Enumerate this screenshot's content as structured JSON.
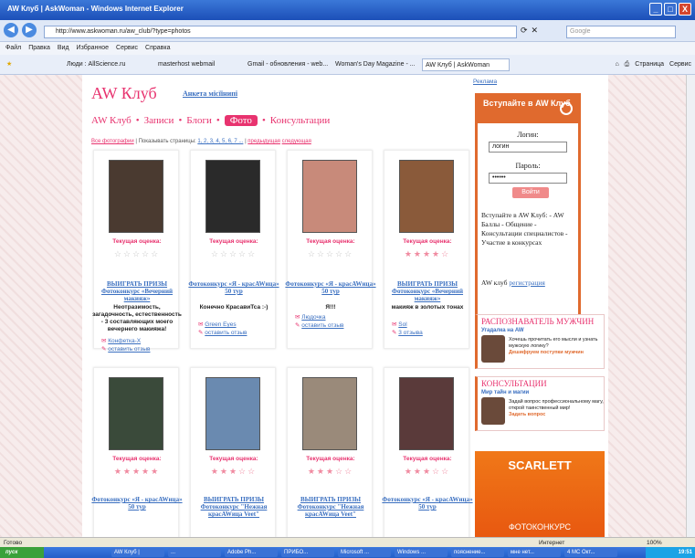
{
  "window": {
    "title": "AW Клуб | AskWoman - Windows Internet Explorer",
    "controls": [
      "_",
      "□",
      "X"
    ]
  },
  "address": {
    "url": "http://www.askwoman.ru/aw_club/?type=photos",
    "search_placeholder": "Google"
  },
  "menu": [
    "Файл",
    "Правка",
    "Вид",
    "Избранное",
    "Сервис",
    "Справка"
  ],
  "favorites": [
    "Люди : AllScience.ru",
    "masterhost webmail",
    "Gmail - обновления - web...",
    "Woman's Day Magazine - ...",
    "AW Клуб | AskWoman"
  ],
  "right_tools": {
    "page": "Страница",
    "service": "Сервис"
  },
  "site": {
    "title": "AW Клуб",
    "anketa": "Анкета місїїнипі",
    "tabs": [
      "AW Клуб",
      "Записи",
      "Блоги",
      "Фото",
      "Консультации"
    ],
    "active_tab": "Фото",
    "pager": {
      "all": "Все фотографии",
      "show": "| Показывать страницы:",
      "pages": "1, 2, 3, 4, 5, 6, 7 ...",
      "sep": "|",
      "prev": "предыдущая",
      "next": "следующая"
    }
  },
  "cards": [
    {
      "rating_label": "Текущая оценка:",
      "stars": "☆☆☆☆☆",
      "contest": "ВЫИГРАТЬ ПРИЗЫ Фотоконкурс «Вечерний макияж»",
      "caption": "Неотразимость, загадочность, естественность - 3 составляющих моего вечернего макияжа!",
      "author": "Конфетка-Х",
      "reply": "оставить отзыв",
      "photo": "#4a3a30"
    },
    {
      "rating_label": "Текущая оценка:",
      "stars": "☆☆☆☆☆",
      "contest": "Фотоконкурс «Я - красAWица» 50 тур",
      "caption": "Конечно КрасавиТса :-)",
      "author": "Green Eyes",
      "reply": "оставить отзыв",
      "photo": "#2a2a2a"
    },
    {
      "rating_label": "Текущая оценка:",
      "stars": "☆☆☆☆☆",
      "contest": "Фотоконкурс «Я - красAWица» 50 тур",
      "caption": "Я!!!",
      "author": "Людочка",
      "reply": "оставить отзыв",
      "photo": "#c88a7a"
    },
    {
      "rating_label": "Текущая оценка:",
      "stars": "★★★★☆",
      "contest": "ВЫИГРАТЬ ПРИЗЫ Фотоконкурс «Вечерний макияж»",
      "caption": "макияж в золотых тонах",
      "author": "Sol",
      "reply": "3 отзыва",
      "photo": "#8a5a3a"
    },
    {
      "rating_label": "Текущая оценка:",
      "stars": "★★★★★",
      "contest": "Фотоконкурс «Я - красAWица» 50 тур",
      "caption": "",
      "author": "",
      "reply": "",
      "photo": "#3a4a3a"
    },
    {
      "rating_label": "Текущая оценка:",
      "stars": "★★★☆☆",
      "contest": "ВЫИГРАТЬ ПРИЗЫ Фотоконкурс \"Нежная красAWица Veet\"",
      "caption": "",
      "author": "",
      "reply": "",
      "photo": "#6a8ab0"
    },
    {
      "rating_label": "Текущая оценка:",
      "stars": "★★★☆☆",
      "contest": "ВЫИГРАТЬ ПРИЗЫ Фотоконкурс \"Нежная красAWица Veet\"",
      "caption": "",
      "author": "",
      "reply": "",
      "photo": "#9a8a7a"
    },
    {
      "rating_label": "Текущая оценка:",
      "stars": "★★★☆☆",
      "contest": "Фотоконкурс «Я - красAWица» 50 тур",
      "caption": "",
      "author": "",
      "reply": "",
      "photo": "#5a3a3a"
    }
  ],
  "sidebar": {
    "reklama": "Реклама",
    "login_title": "Вступайте в AW Клуб",
    "login_label": "Логин:",
    "login_value": "логин",
    "password_label": "Пароль:",
    "password_value": "••••••",
    "submit": "Войти",
    "club_text": "Вступайте в AW Клуб: - AW Баллы - Общение - Консультации специалистов - Участие в конкурсах",
    "club_link_pre": "AW клуб",
    "club_link": "регистрация",
    "promo1_title": "РАСПОЗНАВАТЕЛЬ МУЖЧИН",
    "promo1_sub": "Угадалка на AW",
    "promo1_text": "Хочешь прочитать его мысли и узнать мужскую логику?",
    "promo1_link": "Дешифруем поступки мужчин",
    "promo2_title": "КОНСУЛЬТАЦИИ",
    "promo2_sub": "Мир тайн и магии",
    "promo2_text": "Задай вопрос профессиональному магу, открой таинственный мир!",
    "promo2_link": "Задать вопрос",
    "ad_brand": "SCARLETT",
    "ad_text": "ФОТОКОНКУРС"
  },
  "status": {
    "left": "Готово",
    "zone": "Интернет",
    "zoom": "100%"
  },
  "taskbar": {
    "start": "пуск",
    "tasks": [
      "AW Клуб |",
      "...",
      "Adobe Ph...",
      "ПРИБО...",
      "Microsoft ...",
      "Windows ...",
      "пояснение...",
      "мне нет...",
      "4 МС Окт..."
    ],
    "clock": "19:51"
  }
}
